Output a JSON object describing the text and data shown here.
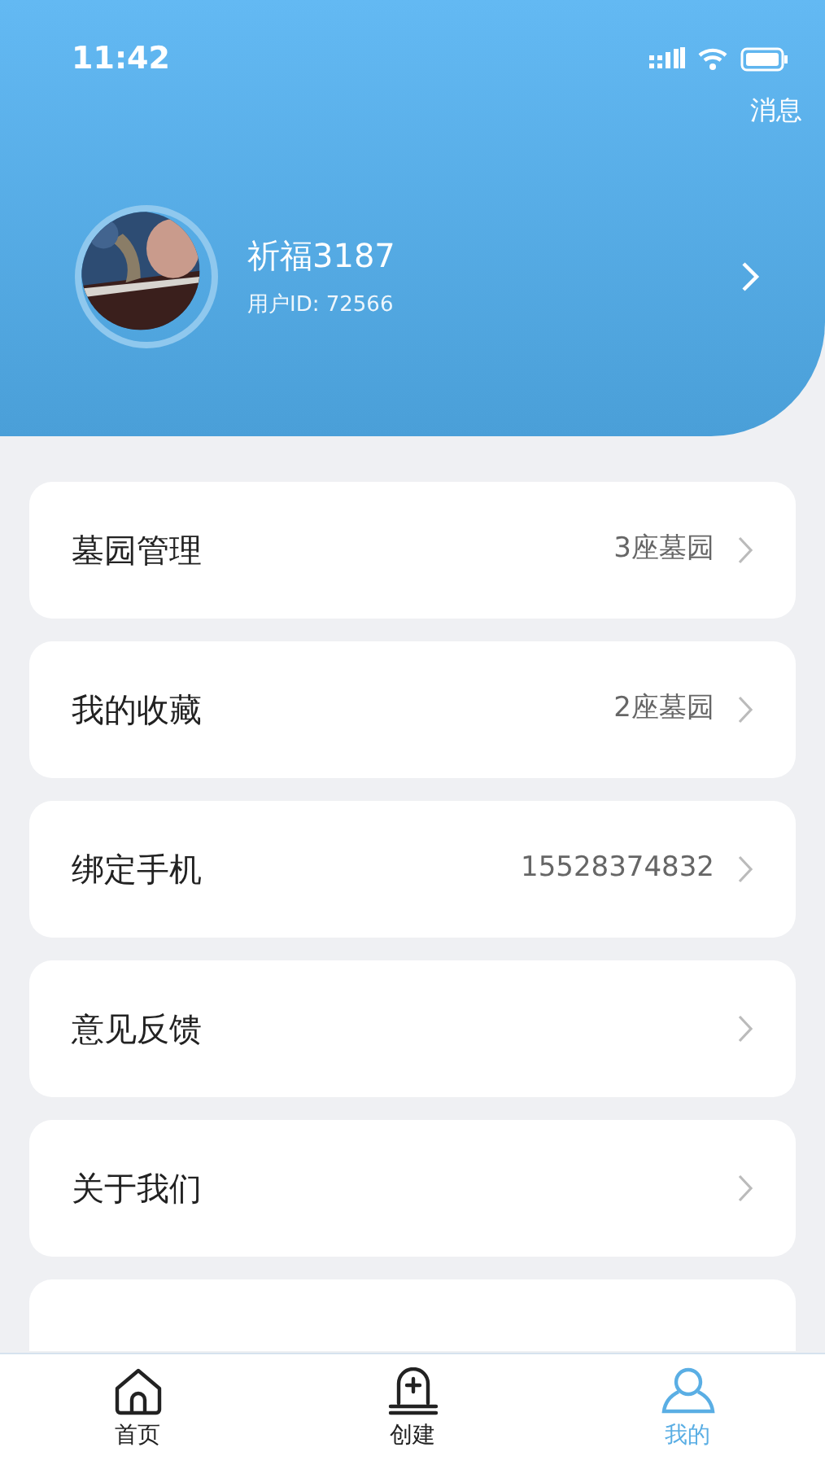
{
  "status_bar": {
    "time": "11:42"
  },
  "header": {
    "message_link": "消息",
    "user": {
      "name": "祈福3187",
      "user_id": "用户ID: 72566"
    }
  },
  "menu": [
    {
      "label": "墓园管理",
      "value": "3座墓园"
    },
    {
      "label": "我的收藏",
      "value": "2座墓园"
    },
    {
      "label": "绑定手机",
      "value": "15528374832"
    },
    {
      "label": "意见反馈"
    },
    {
      "label": "关于我们"
    }
  ],
  "tab_bar": [
    {
      "label": "首页",
      "kind": "home",
      "selected": false
    },
    {
      "label": "创建",
      "kind": "tomb",
      "selected": false
    },
    {
      "label": "我的",
      "kind": "person",
      "selected": true
    }
  ]
}
